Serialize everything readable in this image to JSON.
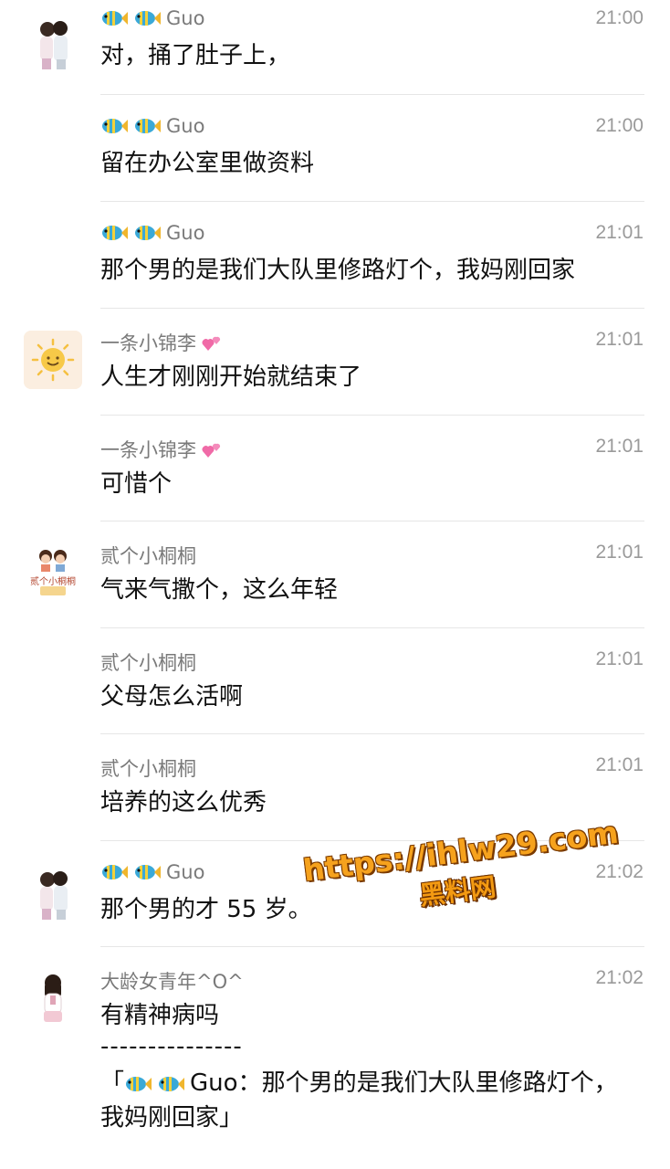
{
  "messages": [
    {
      "name": "Guo",
      "time": "21:00",
      "text": "对，捅了肚子上，"
    },
    {
      "name": "Guo",
      "time": "21:00",
      "text": "留在办公室里做资料"
    },
    {
      "name": "Guo",
      "time": "21:01",
      "text": "那个男的是我们大队里修路灯个，我妈刚回家"
    },
    {
      "name": "一条小锦李",
      "time": "21:01",
      "text": "人生才刚刚开始就结束了"
    },
    {
      "name": "一条小锦李",
      "time": "21:01",
      "text": "可惜个"
    },
    {
      "name": "贰个小桐桐",
      "time": "21:01",
      "text": "气来气撒个，这么年轻"
    },
    {
      "name": "贰个小桐桐",
      "time": "21:01",
      "text": "父母怎么活啊"
    },
    {
      "name": "贰个小桐桐",
      "time": "21:01",
      "text": "培养的这么优秀"
    },
    {
      "name": "Guo",
      "time": "21:02",
      "text": "那个男的才 55 岁。"
    },
    {
      "name": "大龄女青年^O^",
      "time": "21:02",
      "text": "有精神病吗",
      "quote_divider": "---------------",
      "quote_open": "「",
      "quote_author": "Guo：",
      "quote_text": "那个男的是我们大队里修路灯个，我妈刚回家」"
    }
  ],
  "avatar_art": {
    "tongtong_label": "贰个小桐桐"
  },
  "watermark": {
    "url": "https://ihlw29.com",
    "label": "黑料网"
  },
  "icons": {
    "fish": "tropical-fish-icon",
    "heart": "two-hearts-icon",
    "sun": "sun-face-icon"
  },
  "colors": {
    "name_gray": "#7a7a7a",
    "time_gray": "#9a9a9a",
    "separator": "#e6e6e6",
    "watermark_orange": "#f6a21d"
  }
}
